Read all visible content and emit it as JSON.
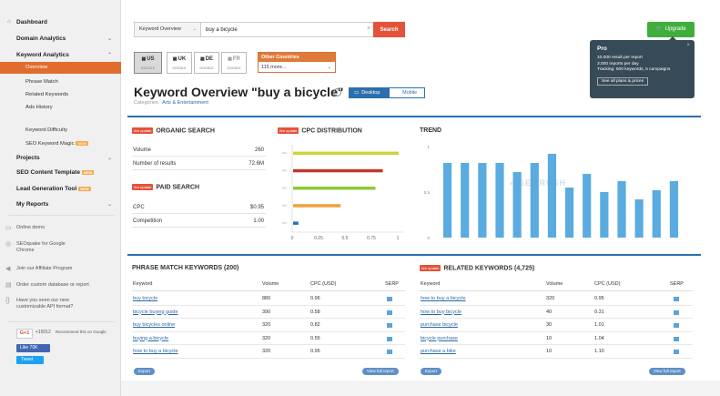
{
  "sidebar": {
    "dashboard": "Dashboard",
    "domain_analytics": "Domain Analytics",
    "keyword_analytics": "Keyword Analytics",
    "overview": "Overview",
    "phrase_match": "Phrase Match",
    "related_keywords": "Related Keywords",
    "ads_history": "Ads History",
    "keyword_difficulty": "Keyword Difficulty",
    "seo_keyword_magic": "SEO Keyword Magic",
    "projects": "Projects",
    "seo_content_template": "SEO Content Template",
    "lead_generation_tool": "Lead Generation Tool",
    "my_reports": "My Reports",
    "badge": "NEW",
    "online_demo": "Online demo",
    "seoquake": "SEOquake for Google Chrome",
    "affiliate": "Join our Affiliate Program",
    "order_custom": "Order custom database or report",
    "api_format": "Have you seen our new customizable API format?",
    "gplus_count": "+15012",
    "gplus_text": "Recommend this on Google",
    "like_label": "Like 70K",
    "tweet_label": "Tweet"
  },
  "search": {
    "database": "Keyword Overview",
    "query": "buy a bicycle",
    "button": "Search"
  },
  "upgrade": {
    "label": "Upgrade",
    "tip_title": "Pro",
    "tip_line1": "10,000 result per report",
    "tip_line2": "3,000 reports per day",
    "tip_line3": "Tracking: 500 keywords, 5 campaigns",
    "tip_button": "See all plans & prices"
  },
  "flags": [
    {
      "code": "US",
      "sub": "GOOGLE"
    },
    {
      "code": "UK",
      "sub": "GOOGLE"
    },
    {
      "code": "DE",
      "sub": "GOOGLE"
    },
    {
      "code": "FR",
      "sub": "GOOGLE"
    }
  ],
  "other_countries": {
    "label": "Other Countries",
    "value": "115 more..."
  },
  "header": {
    "title": "Keyword Overview \"buy a bicycle\"",
    "desktop": "Desktop",
    "mobile": "Mobile",
    "categories_label": "Categories:",
    "category": "Arts & Entertainment"
  },
  "live_label": "live update",
  "organic": {
    "title": "ORGANIC SEARCH",
    "rows": [
      {
        "label": "Volume",
        "value": "260"
      },
      {
        "label": "Number of results",
        "value": "72.6M"
      }
    ]
  },
  "paid": {
    "title": "PAID SEARCH",
    "rows": [
      {
        "label": "CPC",
        "value": "$0.95"
      },
      {
        "label": "Competition",
        "value": "1.00"
      }
    ]
  },
  "cpc": {
    "title": "CPC DISTRIBUTION"
  },
  "trend": {
    "title": "TREND"
  },
  "chart_data": [
    {
      "type": "bar",
      "orientation": "horizontal",
      "title": "CPC DISTRIBUTION",
      "categories": [
        "",
        "",
        "",
        "",
        ""
      ],
      "values": [
        1.0,
        0.85,
        0.78,
        0.45,
        0.05
      ],
      "colors": [
        "#c8d63b",
        "#c0392b",
        "#8fc93a",
        "#f0a13a",
        "#2c6fad"
      ],
      "xticks": [
        "0",
        "0.25",
        "0.5",
        "0.75",
        "1"
      ],
      "xlim": [
        0,
        1
      ]
    },
    {
      "type": "bar",
      "title": "TREND",
      "values": [
        0.82,
        0.82,
        0.82,
        0.82,
        0.72,
        0.82,
        0.92,
        0.55,
        0.7,
        0.5,
        0.62,
        0.42,
        0.52,
        0.62
      ],
      "yticks": [
        "1",
        "0.5",
        "0"
      ],
      "ylim": [
        0,
        1
      ],
      "color": "#5aabe0"
    }
  ],
  "phrase": {
    "title": "PHRASE MATCH KEYWORDS (200)",
    "headers": [
      "Keyword",
      "Volume",
      "CPC (USD)",
      "SERP"
    ],
    "rows": [
      {
        "kw": "buy bicycle",
        "vol": "880",
        "cpc": "0.96"
      },
      {
        "kw": "bicycle buying guide",
        "vol": "390",
        "cpc": "0.58"
      },
      {
        "kw": "buy bicycles online",
        "vol": "320",
        "cpc": "0.82"
      },
      {
        "kw": "buying a bicycle",
        "vol": "320",
        "cpc": "0.55"
      },
      {
        "kw": "how to buy a bicycle",
        "vol": "320",
        "cpc": "0.95"
      }
    ],
    "export": "Export",
    "full_report": "View full report"
  },
  "related": {
    "title": "RELATED KEYWORDS (4,725)",
    "headers": [
      "Keyword",
      "Volume",
      "CPC (USD)",
      "SERP"
    ],
    "rows": [
      {
        "kw": "how to buy a bicycle",
        "vol": "320",
        "cpc": "0.95"
      },
      {
        "kw": "how to buy bicycle",
        "vol": "40",
        "cpc": "0.31"
      },
      {
        "kw": "purchase bicycle",
        "vol": "30",
        "cpc": "1.01"
      },
      {
        "kw": "bicycle purchase",
        "vol": "10",
        "cpc": "1.04"
      },
      {
        "kw": "purchase a bike",
        "vol": "10",
        "cpc": "1.10"
      }
    ],
    "export": "Export",
    "full_report": "View full report"
  }
}
